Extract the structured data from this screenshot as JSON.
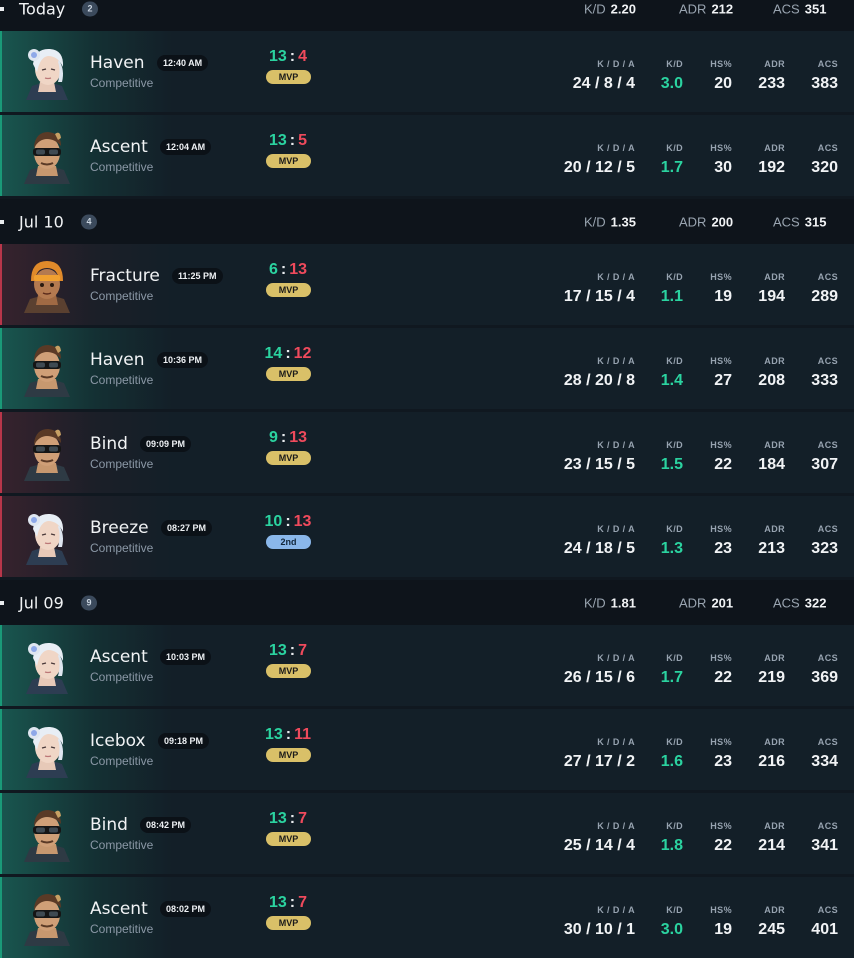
{
  "days": [
    {
      "label": "Today",
      "count": "2",
      "kd_label": "K/D",
      "kd": "2.20",
      "adr_label": "ADR",
      "adr": "212",
      "acs_label": "ACS",
      "acs": "351",
      "matches": [
        {
          "map": "Haven",
          "time": "12:40 AM",
          "mode": "Competitive",
          "won": "13",
          "lost": "4",
          "result": "win",
          "placement": "MVP",
          "agent": "white-hair-agent",
          "kda": "24 / 8 / 4",
          "kd": "3.0",
          "hs": "20",
          "adr": "233",
          "acs": "383"
        },
        {
          "map": "Ascent",
          "time": "12:04 AM",
          "mode": "Competitive",
          "won": "13",
          "lost": "5",
          "result": "win",
          "placement": "MVP",
          "agent": "goggles-agent",
          "kda": "20 / 12 / 5",
          "kd": "1.7",
          "hs": "30",
          "adr": "192",
          "acs": "320"
        }
      ]
    },
    {
      "label": "Jul 10",
      "count": "4",
      "kd_label": "K/D",
      "kd": "1.35",
      "adr_label": "ADR",
      "adr": "200",
      "acs_label": "ACS",
      "acs": "315",
      "matches": [
        {
          "map": "Fracture",
          "time": "11:25 PM",
          "mode": "Competitive",
          "won": "6",
          "lost": "13",
          "result": "loss",
          "placement": "MVP",
          "agent": "helmet-agent",
          "kda": "17 / 15 / 4",
          "kd": "1.1",
          "hs": "19",
          "adr": "194",
          "acs": "289"
        },
        {
          "map": "Haven",
          "time": "10:36 PM",
          "mode": "Competitive",
          "won": "14",
          "lost": "12",
          "result": "win",
          "placement": "MVP",
          "agent": "goggles-agent",
          "kda": "28 / 20 / 8",
          "kd": "1.4",
          "hs": "27",
          "adr": "208",
          "acs": "333"
        },
        {
          "map": "Bind",
          "time": "09:09 PM",
          "mode": "Competitive",
          "won": "9",
          "lost": "13",
          "result": "loss",
          "placement": "MVP",
          "agent": "goggles-agent",
          "kda": "23 / 15 / 5",
          "kd": "1.5",
          "hs": "22",
          "adr": "184",
          "acs": "307"
        },
        {
          "map": "Breeze",
          "time": "08:27 PM",
          "mode": "Competitive",
          "won": "10",
          "lost": "13",
          "result": "loss",
          "placement": "2nd",
          "agent": "white-hair-agent",
          "kda": "24 / 18 / 5",
          "kd": "1.3",
          "hs": "23",
          "adr": "213",
          "acs": "323"
        }
      ]
    },
    {
      "label": "Jul 09",
      "count": "9",
      "kd_label": "K/D",
      "kd": "1.81",
      "adr_label": "ADR",
      "adr": "201",
      "acs_label": "ACS",
      "acs": "322",
      "matches": [
        {
          "map": "Ascent",
          "time": "10:03 PM",
          "mode": "Competitive",
          "won": "13",
          "lost": "7",
          "result": "win",
          "placement": "MVP",
          "agent": "white-hair-agent",
          "kda": "26 / 15 / 6",
          "kd": "1.7",
          "hs": "22",
          "adr": "219",
          "acs": "369"
        },
        {
          "map": "Icebox",
          "time": "09:18 PM",
          "mode": "Competitive",
          "won": "13",
          "lost": "11",
          "result": "win",
          "placement": "MVP",
          "agent": "white-hair-agent",
          "kda": "27 / 17 / 2",
          "kd": "1.6",
          "hs": "23",
          "adr": "216",
          "acs": "334"
        },
        {
          "map": "Bind",
          "time": "08:42 PM",
          "mode": "Competitive",
          "won": "13",
          "lost": "7",
          "result": "win",
          "placement": "MVP",
          "agent": "goggles-agent",
          "kda": "25 / 14 / 4",
          "kd": "1.8",
          "hs": "22",
          "adr": "214",
          "acs": "341"
        },
        {
          "map": "Ascent",
          "time": "08:02 PM",
          "mode": "Competitive",
          "won": "13",
          "lost": "7",
          "result": "win",
          "placement": "MVP",
          "agent": "goggles-agent",
          "kda": "30 / 10 / 1",
          "kd": "3.0",
          "hs": "19",
          "adr": "245",
          "acs": "401"
        }
      ]
    }
  ],
  "stat_labels": {
    "kda": "K / D / A",
    "kd": "K/D",
    "hs": "HS%",
    "adr": "ADR",
    "acs": "ACS"
  },
  "colors": {
    "win": "#2bd3a0",
    "loss": "#ef4a5c",
    "mvp": "#d9c068",
    "second": "#8ab7ea"
  }
}
